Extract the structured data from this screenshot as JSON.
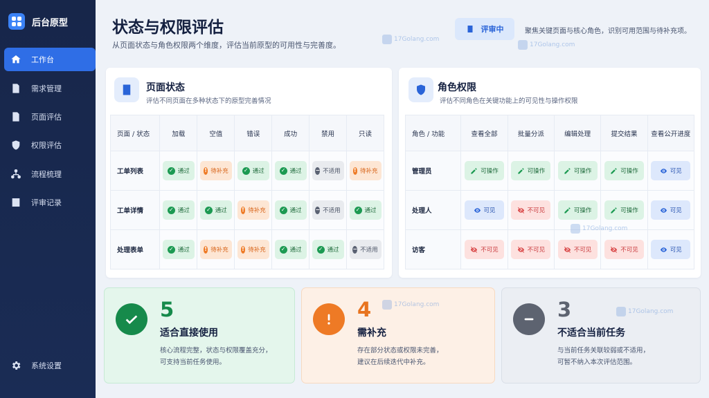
{
  "app": {
    "name": "后台原型"
  },
  "sidebar": {
    "items": [
      {
        "label": "工作台",
        "icon": "home-icon",
        "active": true
      },
      {
        "label": "需求管理",
        "icon": "document-icon",
        "active": false
      },
      {
        "label": "页面评估",
        "icon": "page-icon",
        "active": false
      },
      {
        "label": "权限评估",
        "icon": "shield-icon",
        "active": false
      },
      {
        "label": "流程梳理",
        "icon": "flow-icon",
        "active": false
      },
      {
        "label": "评审记录",
        "icon": "record-icon",
        "active": false
      }
    ],
    "settings": {
      "label": "系统设置",
      "icon": "gear-icon"
    }
  },
  "header": {
    "title": "状态与权限评估",
    "subtitle": "从页面状态与角色权限两个维度，评估当前原型的可用性与完善度。",
    "badge": "评审中",
    "note": "聚焦关键页面与核心角色，识别可用范围与待补充项。"
  },
  "page_state": {
    "title": "页面状态",
    "desc": "评估不同页面在多种状态下的原型完善情况",
    "corner": "页面 / 状态",
    "columns": [
      "加载",
      "空值",
      "错误",
      "成功",
      "禁用",
      "只读"
    ],
    "rows": [
      {
        "name": "工单列表",
        "cells": [
          "通过",
          "待补充",
          "通过",
          "通过",
          "不适用",
          "待补充"
        ]
      },
      {
        "name": "工单详情",
        "cells": [
          "通过",
          "通过",
          "待补充",
          "通过",
          "不适用",
          "通过"
        ]
      },
      {
        "name": "处理表单",
        "cells": [
          "通过",
          "待补充",
          "待补充",
          "通过",
          "通过",
          "不适用"
        ]
      }
    ]
  },
  "role_perm": {
    "title": "角色权限",
    "desc": "评估不同角色在关键功能上的可见性与操作权限",
    "corner": "角色 / 功能",
    "columns": [
      "查看全部",
      "批量分派",
      "编辑处理",
      "提交结果",
      "查看公开进度"
    ],
    "rows": [
      {
        "name": "管理员",
        "cells": [
          "可操作",
          "可操作",
          "可操作",
          "可操作",
          "可见"
        ]
      },
      {
        "name": "处理人",
        "cells": [
          "可见",
          "不可见",
          "可操作",
          "可操作",
          "可见"
        ]
      },
      {
        "name": "访客",
        "cells": [
          "不可见",
          "不可见",
          "不可见",
          "不可见",
          "可见"
        ]
      }
    ]
  },
  "summary": [
    {
      "count": "5",
      "title": "适合直接使用",
      "line1": "核心流程完整，状态与权限覆盖充分，",
      "line2": "可支持当前任务使用。",
      "color": "#168a4b"
    },
    {
      "count": "4",
      "title": "需补充",
      "line1": "存在部分状态或权限未完善，",
      "line2": "建议在后续迭代中补充。",
      "color": "#e8741f"
    },
    {
      "count": "3",
      "title": "不适合当前任务",
      "line1": "与当前任务关联较弱或不适用，",
      "line2": "可暂不纳入本次评估范围。",
      "color": "#5d6370"
    }
  ],
  "watermark": "17Golang.com"
}
